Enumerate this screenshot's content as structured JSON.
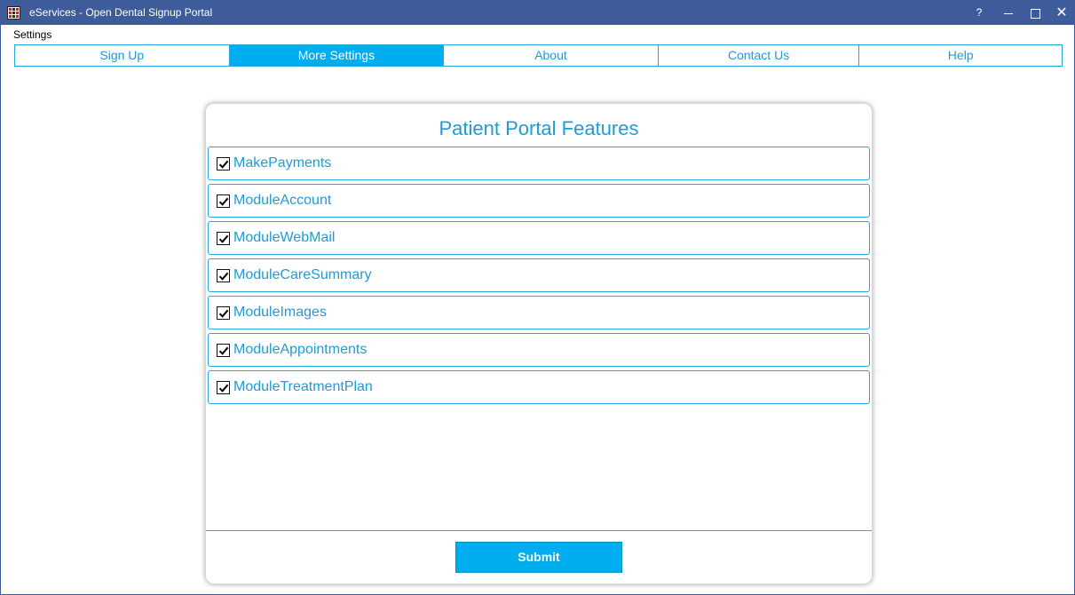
{
  "window": {
    "title": "eServices - Open Dental Signup Portal",
    "help_label": "?",
    "close_label": "✕"
  },
  "menu": {
    "settings": "Settings"
  },
  "tabs": [
    {
      "label": "Sign Up",
      "active": false
    },
    {
      "label": "More Settings",
      "active": true
    },
    {
      "label": "About",
      "active": false
    },
    {
      "label": "Contact Us",
      "active": false
    },
    {
      "label": "Help",
      "active": false
    }
  ],
  "card": {
    "title": "Patient Portal Features",
    "features": [
      {
        "label": "MakePayments",
        "checked": true
      },
      {
        "label": "ModuleAccount",
        "checked": true
      },
      {
        "label": "ModuleWebMail",
        "checked": true
      },
      {
        "label": "ModuleCareSummary",
        "checked": true
      },
      {
        "label": "ModuleImages",
        "checked": true
      },
      {
        "label": "ModuleAppointments",
        "checked": true
      },
      {
        "label": "ModuleTreatmentPlan",
        "checked": true
      }
    ],
    "submit_label": "Submit"
  },
  "colors": {
    "accent": "#00adef",
    "text_accent": "#1f9bd6",
    "titlebar": "#3f5c9a"
  }
}
